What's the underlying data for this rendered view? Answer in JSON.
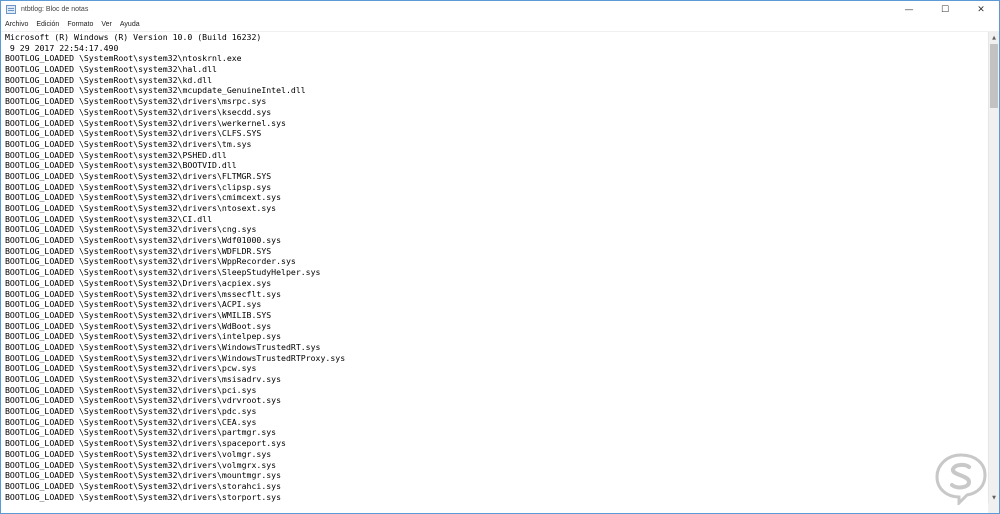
{
  "window": {
    "title": "ntbtlog: Bloc de notas",
    "controls": {
      "minimize": "—",
      "maximize": "☐",
      "close": "✕"
    }
  },
  "menu": [
    "Archivo",
    "Edición",
    "Formato",
    "Ver",
    "Ayuda"
  ],
  "content": {
    "lines": [
      "Microsoft (R) Windows (R) Version 10.0 (Build 16232)",
      " 9 29 2017 22:54:17.490",
      "BOOTLOG_LOADED \\SystemRoot\\system32\\ntoskrnl.exe",
      "BOOTLOG_LOADED \\SystemRoot\\system32\\hal.dll",
      "BOOTLOG_LOADED \\SystemRoot\\system32\\kd.dll",
      "BOOTLOG_LOADED \\SystemRoot\\system32\\mcupdate_GenuineIntel.dll",
      "BOOTLOG_LOADED \\SystemRoot\\System32\\drivers\\msrpc.sys",
      "BOOTLOG_LOADED \\SystemRoot\\System32\\drivers\\ksecdd.sys",
      "BOOTLOG_LOADED \\SystemRoot\\System32\\drivers\\werkernel.sys",
      "BOOTLOG_LOADED \\SystemRoot\\System32\\drivers\\CLFS.SYS",
      "BOOTLOG_LOADED \\SystemRoot\\System32\\drivers\\tm.sys",
      "BOOTLOG_LOADED \\SystemRoot\\system32\\PSHED.dll",
      "BOOTLOG_LOADED \\SystemRoot\\system32\\BOOTVID.dll",
      "BOOTLOG_LOADED \\SystemRoot\\System32\\drivers\\FLTMGR.SYS",
      "BOOTLOG_LOADED \\SystemRoot\\System32\\drivers\\clipsp.sys",
      "BOOTLOG_LOADED \\SystemRoot\\System32\\drivers\\cmimcext.sys",
      "BOOTLOG_LOADED \\SystemRoot\\System32\\drivers\\ntosext.sys",
      "BOOTLOG_LOADED \\SystemRoot\\system32\\CI.dll",
      "BOOTLOG_LOADED \\SystemRoot\\System32\\drivers\\cng.sys",
      "BOOTLOG_LOADED \\SystemRoot\\system32\\drivers\\Wdf01000.sys",
      "BOOTLOG_LOADED \\SystemRoot\\system32\\drivers\\WDFLDR.SYS",
      "BOOTLOG_LOADED \\SystemRoot\\system32\\drivers\\WppRecorder.sys",
      "BOOTLOG_LOADED \\SystemRoot\\system32\\drivers\\SleepStudyHelper.sys",
      "BOOTLOG_LOADED \\SystemRoot\\System32\\Drivers\\acpiex.sys",
      "BOOTLOG_LOADED \\SystemRoot\\System32\\drivers\\mssecflt.sys",
      "BOOTLOG_LOADED \\SystemRoot\\System32\\drivers\\ACPI.sys",
      "BOOTLOG_LOADED \\SystemRoot\\System32\\drivers\\WMILIB.SYS",
      "BOOTLOG_LOADED \\SystemRoot\\System32\\drivers\\WdBoot.sys",
      "BOOTLOG_LOADED \\SystemRoot\\System32\\drivers\\intelpep.sys",
      "BOOTLOG_LOADED \\SystemRoot\\System32\\drivers\\WindowsTrustedRT.sys",
      "BOOTLOG_LOADED \\SystemRoot\\System32\\drivers\\WindowsTrustedRTProxy.sys",
      "BOOTLOG_LOADED \\SystemRoot\\System32\\drivers\\pcw.sys",
      "BOOTLOG_LOADED \\SystemRoot\\System32\\drivers\\msisadrv.sys",
      "BOOTLOG_LOADED \\SystemRoot\\System32\\drivers\\pci.sys",
      "BOOTLOG_LOADED \\SystemRoot\\System32\\drivers\\vdrvroot.sys",
      "BOOTLOG_LOADED \\SystemRoot\\System32\\drivers\\pdc.sys",
      "BOOTLOG_LOADED \\SystemRoot\\System32\\drivers\\CEA.sys",
      "BOOTLOG_LOADED \\SystemRoot\\System32\\drivers\\partmgr.sys",
      "BOOTLOG_LOADED \\SystemRoot\\System32\\drivers\\spaceport.sys",
      "BOOTLOG_LOADED \\SystemRoot\\System32\\drivers\\volmgr.sys",
      "BOOTLOG_LOADED \\SystemRoot\\System32\\drivers\\volmgrx.sys",
      "BOOTLOG_LOADED \\SystemRoot\\System32\\drivers\\mountmgr.sys",
      "BOOTLOG_LOADED \\SystemRoot\\System32\\drivers\\storahci.sys",
      "BOOTLOG_LOADED \\SystemRoot\\System32\\drivers\\storport.sys"
    ]
  },
  "scrollbar": {
    "position_fraction": 0.0
  },
  "watermark": {
    "icon": "solvetic-s-logo",
    "color": "#c8c8c8"
  },
  "colors": {
    "window_border": "#5b9bd5",
    "scrollbar_track": "#f0f0f0",
    "scrollbar_thumb": "#c2c2c2"
  }
}
